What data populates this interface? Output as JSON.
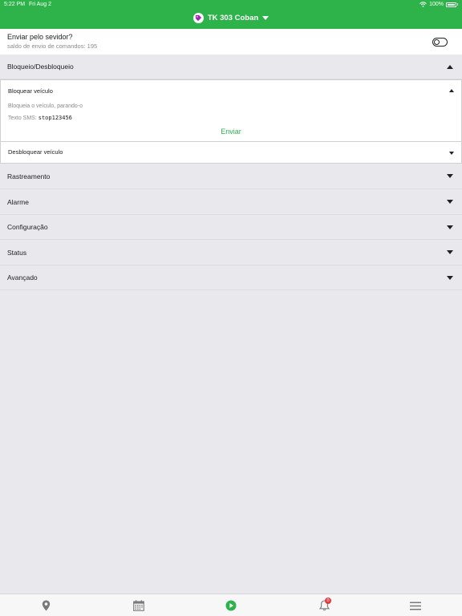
{
  "status_bar": {
    "time": "5:22 PM",
    "date": "Fri Aug 2",
    "battery": "100%"
  },
  "header": {
    "title": "TK 303 Coban"
  },
  "server": {
    "title": "Enviar pelo sevidor?",
    "subtitle": "saldo de envio de comandos: 195"
  },
  "sections": {
    "bloqueio": "Bloqueio/Desbloqueio",
    "rastreamento": "Rastreamento",
    "alarme": "Alarme",
    "configuracao": "Configuração",
    "status": "Status",
    "avancado": "Avançado"
  },
  "bloqueio_panel": {
    "bloquear_label": "Bloquear veículo",
    "description": "Bloqueia o veículo, parando-o",
    "sms_label": "Texto SMS:",
    "sms_code": "stop123456",
    "send_label": "Enviar",
    "desbloquear_label": "Desbloquear veículo"
  },
  "tabbar": {
    "notification_count": "0",
    "icons": [
      "location-pin-icon",
      "calendar-icon",
      "play-icon",
      "bell-icon",
      "menu-icon"
    ]
  },
  "colors": {
    "accent": "#2db34a",
    "badge": "#e53b3b",
    "background": "#e9e8ed"
  }
}
